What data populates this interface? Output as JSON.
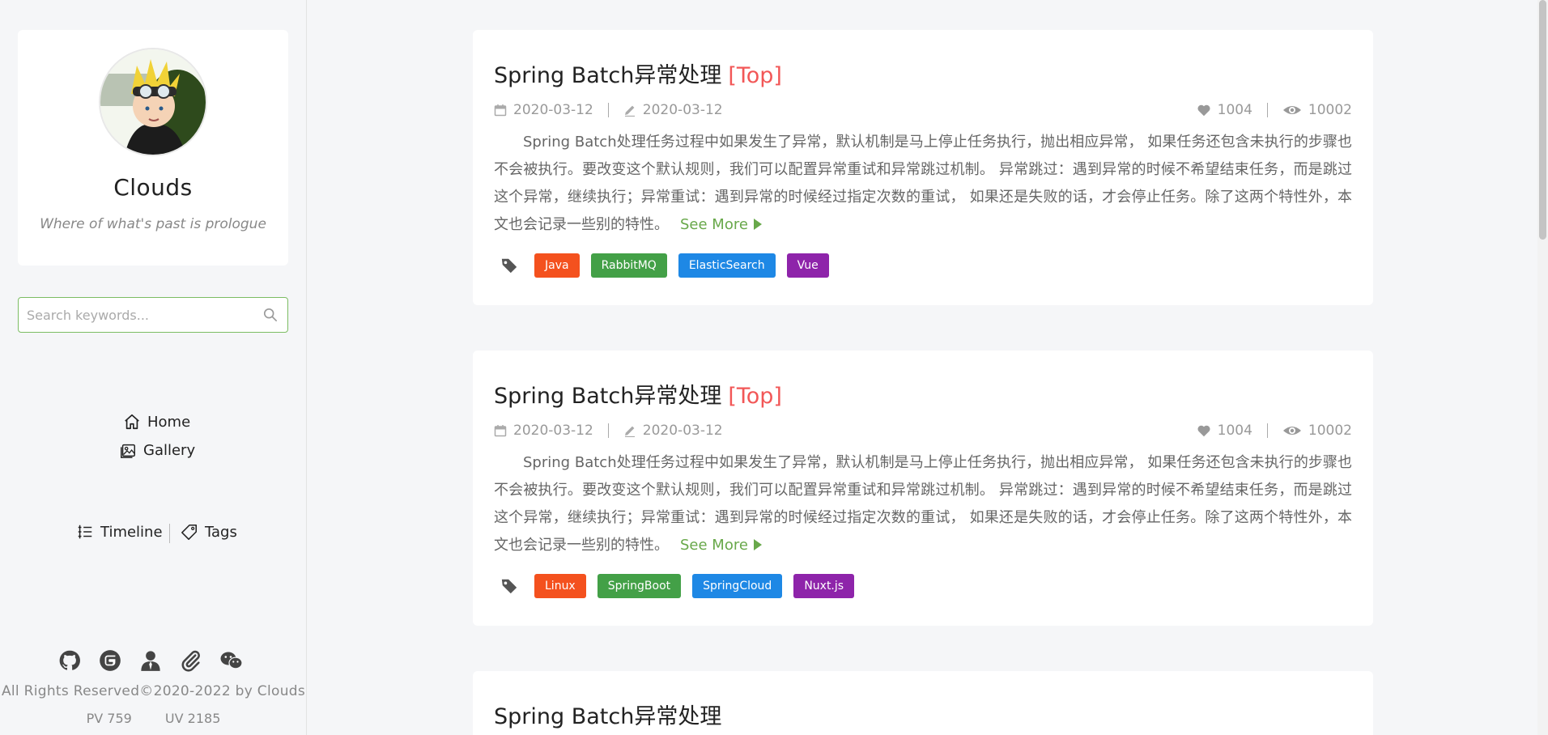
{
  "sidebar": {
    "author": "Clouds",
    "motto": "Where of what's past is prologue",
    "search_placeholder": "Search keywords...",
    "nav": {
      "home": "Home",
      "gallery": "Gallery",
      "timeline": "Timeline",
      "tags": "Tags"
    },
    "social_icons": [
      "github-icon",
      "gitee-icon",
      "user-icon",
      "link-icon",
      "wechat-icon"
    ],
    "copyright": "All Rights Reserved©2020-2022 by Clouds",
    "pv": "PV 759",
    "uv": "UV 2185"
  },
  "posts": [
    {
      "title": "Spring Batch异常处理",
      "badge": "[Top]",
      "created": "2020-03-12",
      "updated": "2020-03-12",
      "likes": "1004",
      "views": "10002",
      "excerpt": "Spring Batch处理任务过程中如果发生了异常，默认机制是马上停止任务执行，抛出相应异常， 如果任务还包含未执行的步骤也不会被执行。要改变这个默认规则，我们可以配置异常重试和异常跳过机制。 异常跳过：遇到异常的时候不希望结束任务，而是跳过这个异常，继续执行；异常重试：遇到异常的时候经过指定次数的重试， 如果还是失败的话，才会停止任务。除了这两个特性外，本文也会记录一些别的特性。",
      "see_more": "See More",
      "tags": [
        {
          "label": "Java",
          "color": "#f4511e"
        },
        {
          "label": "RabbitMQ",
          "color": "#43a047"
        },
        {
          "label": "ElasticSearch",
          "color": "#1e88e5"
        },
        {
          "label": "Vue",
          "color": "#8e24aa"
        }
      ]
    },
    {
      "title": "Spring Batch异常处理",
      "badge": "[Top]",
      "created": "2020-03-12",
      "updated": "2020-03-12",
      "likes": "1004",
      "views": "10002",
      "excerpt": "Spring Batch处理任务过程中如果发生了异常，默认机制是马上停止任务执行，抛出相应异常， 如果任务还包含未执行的步骤也不会被执行。要改变这个默认规则，我们可以配置异常重试和异常跳过机制。 异常跳过：遇到异常的时候不希望结束任务，而是跳过这个异常，继续执行；异常重试：遇到异常的时候经过指定次数的重试， 如果还是失败的话，才会停止任务。除了这两个特性外，本文也会记录一些别的特性。",
      "see_more": "See More",
      "tags": [
        {
          "label": "Linux",
          "color": "#f4511e"
        },
        {
          "label": "SpringBoot",
          "color": "#43a047"
        },
        {
          "label": "SpringCloud",
          "color": "#1e88e5"
        },
        {
          "label": "Nuxt.js",
          "color": "#8e24aa"
        }
      ]
    },
    {
      "title": "Spring Batch异常处理"
    }
  ],
  "colors": {
    "accent_green": "#68a84a",
    "top_red": "#f25757",
    "background": "#f5f6f8"
  }
}
